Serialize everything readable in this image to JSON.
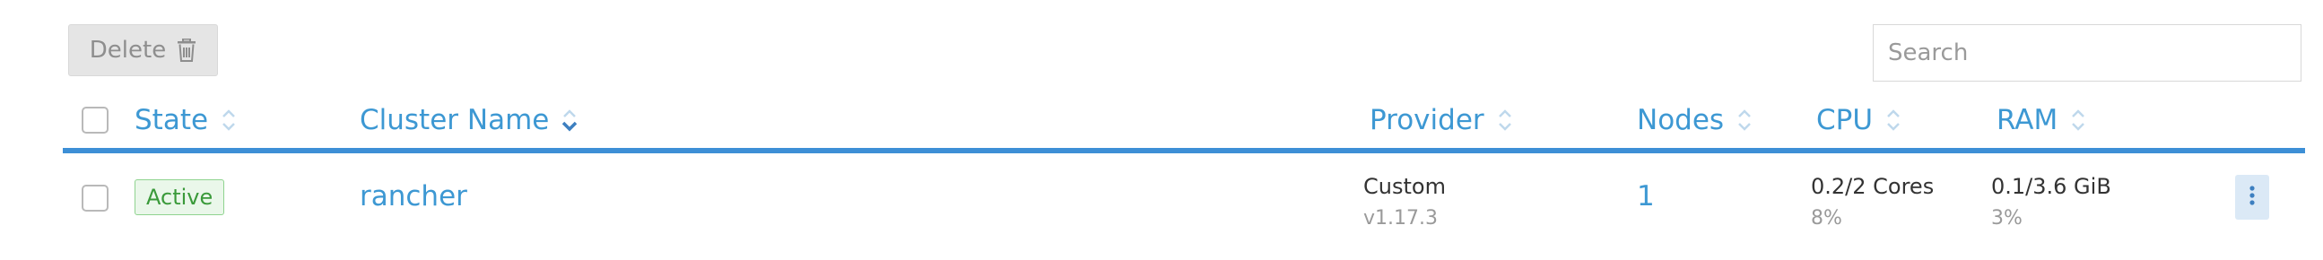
{
  "toolbar": {
    "delete_label": "Delete",
    "delete_icon": "trash-icon",
    "search_placeholder": "Search"
  },
  "table": {
    "columns": [
      {
        "key": "state",
        "label": "State"
      },
      {
        "key": "cluster_name",
        "label": "Cluster Name"
      },
      {
        "key": "provider",
        "label": "Provider"
      },
      {
        "key": "nodes",
        "label": "Nodes"
      },
      {
        "key": "cpu",
        "label": "CPU"
      },
      {
        "key": "ram",
        "label": "RAM"
      }
    ],
    "rows": [
      {
        "state": "Active",
        "cluster_name": "rancher",
        "provider": "Custom",
        "provider_version": "v1.17.3",
        "nodes": "1",
        "cpu": "0.2/2 Cores",
        "cpu_percent": "8%",
        "ram": "0.1/3.6 GiB",
        "ram_percent": "3%"
      }
    ]
  },
  "colors": {
    "accent": "#3d98d3",
    "header_rule": "#3d8fd6",
    "active_badge_text": "#3a9a3a",
    "active_badge_bg": "#eaf7ea"
  }
}
